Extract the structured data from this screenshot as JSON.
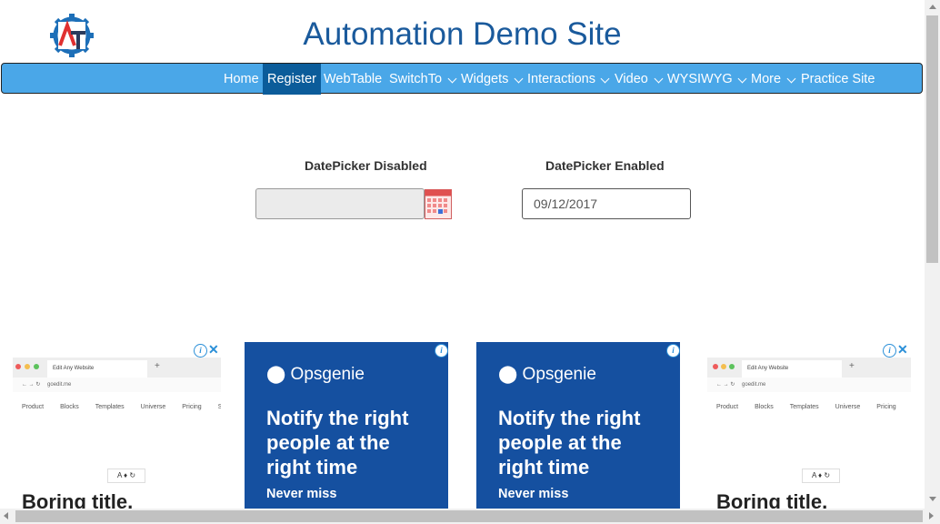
{
  "header": {
    "title": "Automation Demo Site"
  },
  "nav": {
    "items": [
      {
        "label": "Home",
        "dropdown": false
      },
      {
        "label": "Register",
        "dropdown": false,
        "active": true
      },
      {
        "label": "WebTable",
        "dropdown": false
      },
      {
        "label": "SwitchTo",
        "dropdown": true
      },
      {
        "label": "Widgets",
        "dropdown": true
      },
      {
        "label": "Interactions",
        "dropdown": true
      },
      {
        "label": "Video",
        "dropdown": true
      },
      {
        "label": "WYSIWYG",
        "dropdown": true
      },
      {
        "label": "More",
        "dropdown": true
      },
      {
        "label": "Practice Site",
        "dropdown": false
      }
    ]
  },
  "datepicker": {
    "disabled_label": "DatePicker Disabled",
    "disabled_value": "",
    "enabled_label": "DatePicker Enabled",
    "enabled_value": "09/12/2017"
  },
  "ads": {
    "opsgenie_brand": "Opsgenie",
    "opsgenie_headline": "Notify the right people at the right time",
    "opsgenie_sub": "Never miss",
    "goedit_tab": "Edit Any Website",
    "goedit_url": "goedit.me",
    "goedit_menu": [
      "Product",
      "Blocks",
      "Templates",
      "Universe",
      "Pricing",
      "Si"
    ],
    "goedit_toolbar": "A ♦ ↻",
    "goedit_title": "Boring title."
  },
  "colors": {
    "nav_bg": "#4aa7e8",
    "nav_active": "#0b5c9a",
    "title": "#1a5a9c",
    "ad_blue": "#1550a0"
  }
}
